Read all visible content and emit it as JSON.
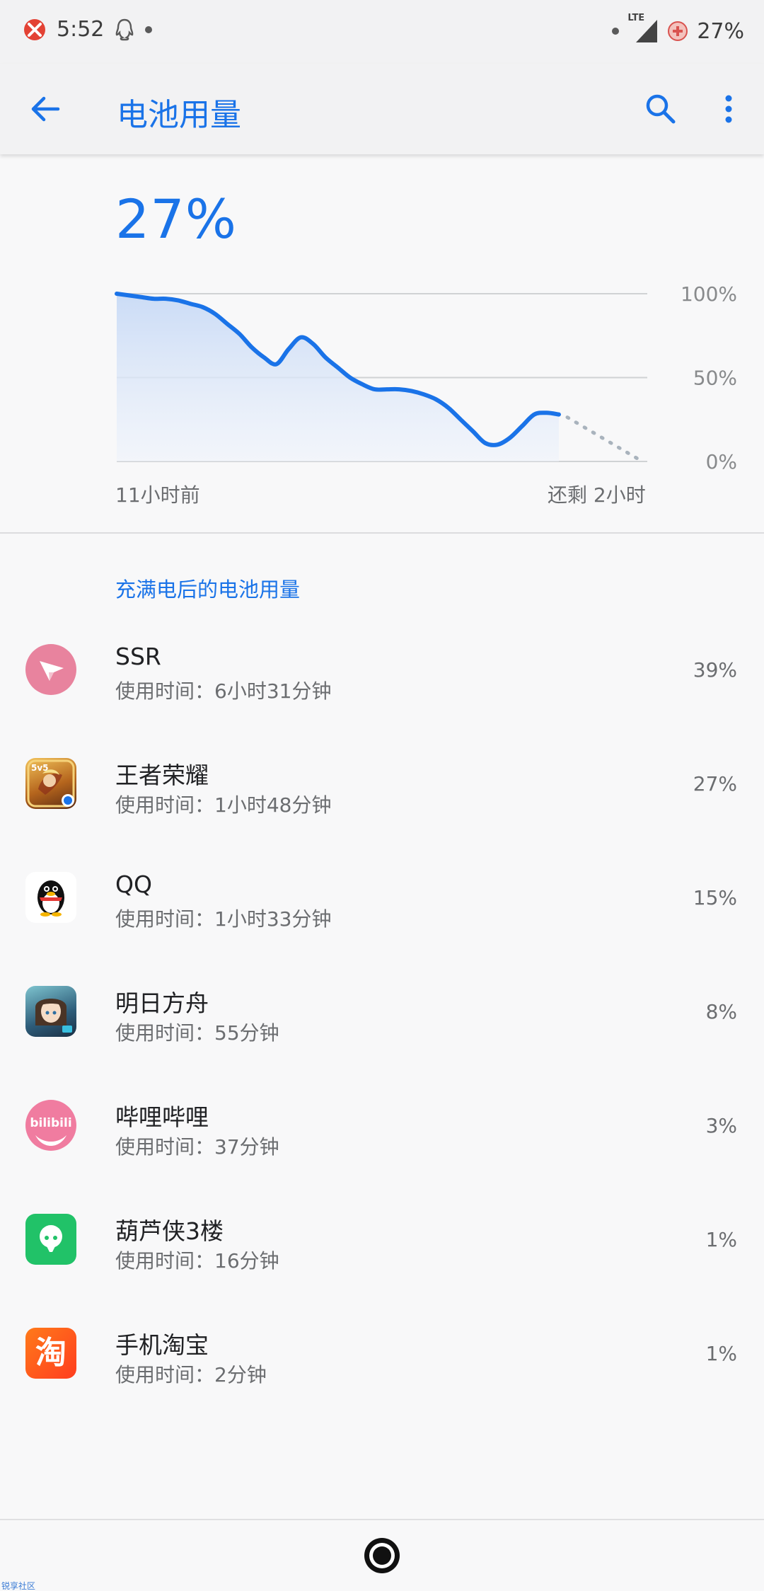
{
  "status_bar": {
    "time": "5:52",
    "network_type": "LTE",
    "battery_percent": "27%"
  },
  "app_bar": {
    "title": "电池用量"
  },
  "summary": {
    "battery_level": "27%"
  },
  "chart_data": {
    "type": "area",
    "x_start_label": "11小时前",
    "x_end_label": "还剩 2小时",
    "y_tick_labels": [
      "100%",
      "50%",
      "0%"
    ],
    "ylim": [
      0,
      100
    ],
    "grid": true,
    "series": [
      {
        "values": [
          100,
          99,
          98,
          97,
          97,
          96,
          94,
          92,
          88,
          82,
          76,
          68,
          62,
          58,
          67,
          74,
          70,
          62,
          56,
          50,
          46,
          43,
          43,
          43,
          42,
          40,
          37,
          32,
          25,
          18,
          11,
          10,
          14,
          21,
          28,
          29,
          28
        ]
      }
    ],
    "projection_end": 0,
    "colors": {
      "line": "#1a73e8",
      "fill_top": "#c8daf6",
      "projection": "#a9b3bd",
      "grid": "#d0d2d4"
    }
  },
  "section": {
    "title": "充满电后的电池用量"
  },
  "apps": [
    {
      "name": "SSR",
      "usage": "使用时间：6小时31分钟",
      "percent": "39%",
      "icon": "ssr-paper-plane-icon",
      "color": "#e8839e"
    },
    {
      "name": "王者荣耀",
      "usage": "使用时间：1小时48分钟",
      "percent": "27%",
      "icon": "honor-of-kings-icon",
      "color": "#c8892b"
    },
    {
      "name": "QQ",
      "usage": "使用时间：1小时33分钟",
      "percent": "15%",
      "icon": "qq-penguin-icon",
      "color": "#111111"
    },
    {
      "name": "明日方舟",
      "usage": "使用时间：55分钟",
      "percent": "8%",
      "icon": "arknights-icon",
      "color": "#2e5d7a"
    },
    {
      "name": "哔哩哔哩",
      "usage": "使用时间：37分钟",
      "percent": "3%",
      "icon": "bilibili-icon",
      "color": "#f07ca0"
    },
    {
      "name": "葫芦侠3楼",
      "usage": "使用时间：16分钟",
      "percent": "1%",
      "icon": "huluxia-icon",
      "color": "#21c268"
    },
    {
      "name": "手机淘宝",
      "usage": "使用时间：2分钟",
      "percent": "1%",
      "icon": "taobao-icon",
      "color": "#ff5218",
      "icon_text": "淘"
    }
  ],
  "watermark": "锐享社区"
}
